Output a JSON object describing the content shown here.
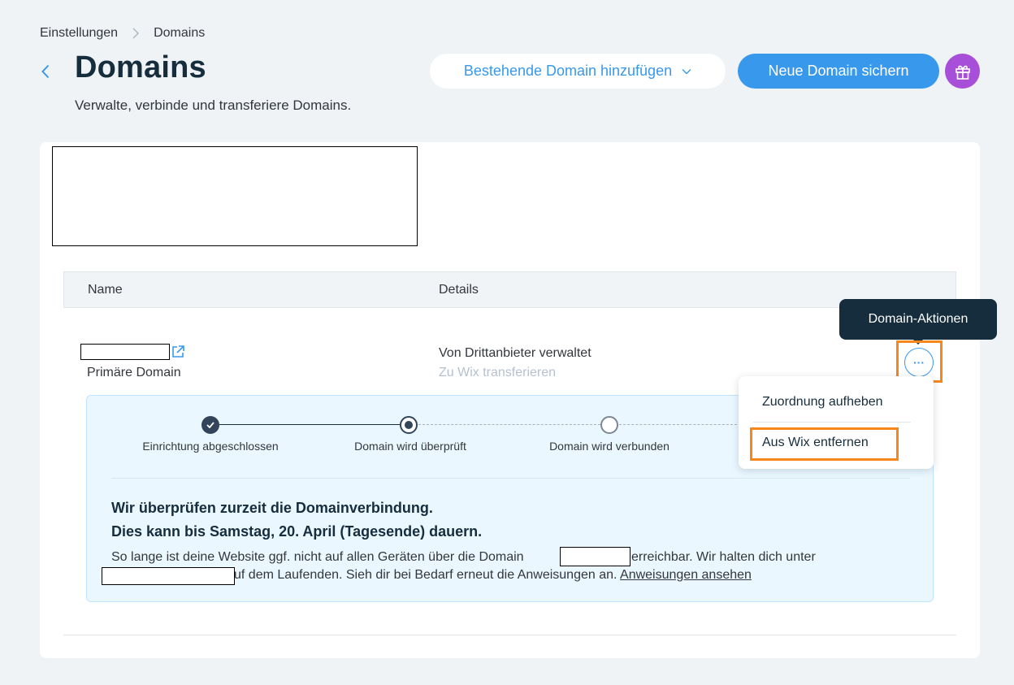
{
  "breadcrumb": {
    "parent": "Einstellungen",
    "current": "Domains"
  },
  "header": {
    "title": "Domains",
    "subtitle": "Verwalte, verbinde und transferiere Domains.",
    "add_existing_label": "Bestehende Domain hinzufügen",
    "new_domain_label": "Neue Domain sichern"
  },
  "table": {
    "col_name": "Name",
    "col_details": "Details",
    "row": {
      "primary_label": "Primäre Domain",
      "managed_by": "Von Drittanbieter verwaltet",
      "transfer_link": "Zu Wix transferieren"
    }
  },
  "progress": {
    "steps": [
      {
        "label": "Einrichtung abgeschlossen",
        "state": "done"
      },
      {
        "label": "Domain wird überprüft",
        "state": "current"
      },
      {
        "label": "Domain wird verbunden",
        "state": "pending"
      }
    ],
    "title_line1": "Wir überprüfen zurzeit die Domainverbindung.",
    "title_line2": "Dies kann bis Samstag, 20. April (Tagesende) dauern.",
    "text_line1_a": "So lange ist deine Website ggf. nicht auf allen Geräten über die Domain",
    "text_line1_b": "erreichbar. Wir halten dich unter",
    "text_line2": "uf dem Laufenden. Sieh dir bei Bedarf erneut die Anweisungen an.",
    "instructions_link": "Anweisungen ansehen"
  },
  "tooltip": {
    "label": "Domain-Aktionen"
  },
  "actions_menu": {
    "items": [
      "Zuordnung aufheben",
      "Aus Wix entfernen"
    ]
  },
  "colors": {
    "accent": "#3899ec",
    "gift": "#a74fd8",
    "highlight": "#f7861b",
    "dark": "#162d3d"
  }
}
